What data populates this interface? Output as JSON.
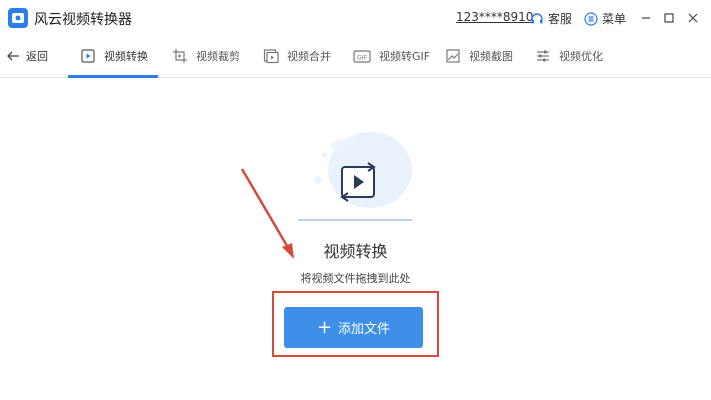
{
  "app": {
    "title": "风云视频转换器",
    "account": "123****8910",
    "support_label": "客服",
    "menu_label": "菜单"
  },
  "toolbar": {
    "back_label": "返回",
    "tabs": [
      {
        "label": "视频转换",
        "icon": "video-convert-icon",
        "active": true
      },
      {
        "label": "视频裁剪",
        "icon": "video-crop-icon",
        "active": false
      },
      {
        "label": "视频合并",
        "icon": "video-merge-icon",
        "active": false
      },
      {
        "label": "视频转GIF",
        "icon": "gif-icon",
        "active": false
      },
      {
        "label": "视频截图",
        "icon": "screenshot-icon",
        "active": false
      },
      {
        "label": "视频优化",
        "icon": "optimize-icon",
        "active": false
      }
    ]
  },
  "main": {
    "title": "视频转换",
    "hint": "将视频文件拖拽到此处",
    "add_button_label": "添加文件"
  },
  "colors": {
    "accent": "#2b7de9",
    "button": "#3d8fe8",
    "annotation": "#d44a3d"
  }
}
